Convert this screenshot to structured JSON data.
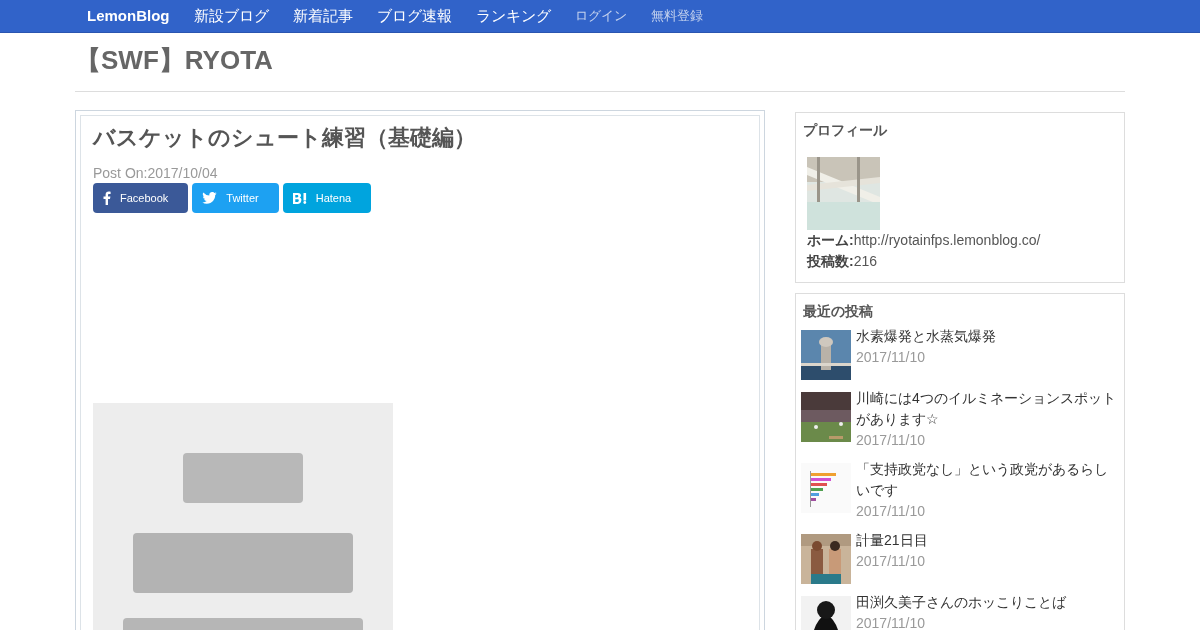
{
  "nav": {
    "items": [
      {
        "label": "LemonBlog",
        "kind": "brand"
      },
      {
        "label": "新設ブログ",
        "kind": "link"
      },
      {
        "label": "新着記事",
        "kind": "link"
      },
      {
        "label": "ブログ速報",
        "kind": "link"
      },
      {
        "label": "ランキング",
        "kind": "link"
      },
      {
        "label": "ログイン",
        "kind": "muted"
      },
      {
        "label": "無料登録",
        "kind": "muted"
      }
    ]
  },
  "blog_title": "【SWF】RYOTA",
  "article": {
    "title": "バスケットのシュート練習（基礎編）",
    "posted": "Post On:2017/10/04",
    "share_buttons": [
      {
        "label": "Facebook",
        "kind": "facebook"
      },
      {
        "label": "Twitter",
        "kind": "twitter"
      },
      {
        "label": "Hatena",
        "kind": "hatena"
      }
    ]
  },
  "profile": {
    "heading": "プロフィール",
    "fields": [
      "**ホーム:**http://ryotainfps.lemonblog.co/",
      "**投稿数:**216"
    ]
  },
  "recent_posts": {
    "heading": "最近の投稿",
    "items": [
      {
        "title": "水素爆発と水蒸気爆発",
        "date": "2017/11/10"
      },
      {
        "title": "川崎には4つのイルミネーションスポットがあります☆",
        "date": "2017/11/10"
      },
      {
        "title": "「支持政党なし」という政党があるらしいです",
        "date": "2017/11/10"
      },
      {
        "title": "計量21日目",
        "date": "2017/11/10"
      },
      {
        "title": "田渕久美子さんのホッこりことば",
        "date": "2017/11/10"
      }
    ]
  }
}
